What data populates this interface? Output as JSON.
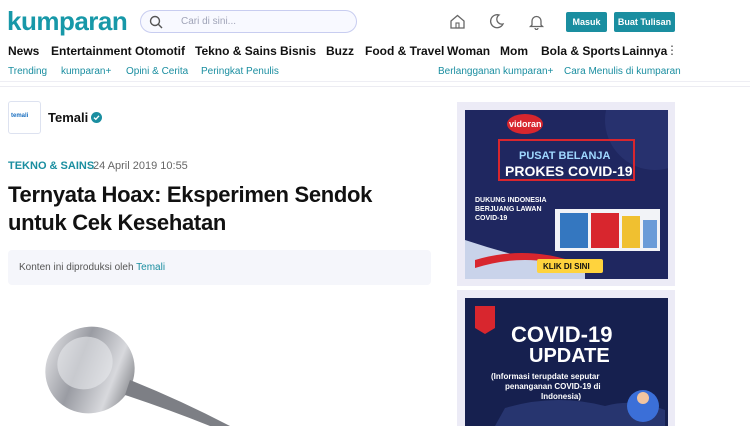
{
  "header": {
    "logo": "kumparan",
    "search_placeholder": "Cari di sini...",
    "login_label": "Masuk",
    "write_label": "Buat Tulisan"
  },
  "nav": {
    "items": [
      "News",
      "Entertainment",
      "Otomotif",
      "Tekno & Sains",
      "Bisnis",
      "Buzz",
      "Food & Travel",
      "Woman",
      "Mom",
      "Bola & Sports",
      "Lainnya"
    ],
    "more": "⋮"
  },
  "subnav": {
    "left": [
      "Trending",
      "kumparan+",
      "Opini & Cerita",
      "Peringkat Penulis"
    ],
    "right": [
      "Berlangganan kumparan+",
      "Cara Menulis di kumparan"
    ]
  },
  "article": {
    "author_logo_text": "temali",
    "author": "Temali",
    "category": "TEKNO & SAINS",
    "date": "24 April 2019 10:55",
    "date_separator": "·",
    "title": "Ternyata Hoax: Eksperimen Sendok untuk Cek Kesehatan",
    "notice_prefix": "Konten ini diproduksi oleh",
    "notice_link": "Temali"
  },
  "ad1": {
    "brand": "vidoran",
    "line1": "PUSAT BELANJA",
    "line2": "PROKES COVID-19",
    "line3": "DUKUNG INDONESIA",
    "line4": "BERJUANG LAWAN",
    "line5": "COVID-19",
    "cta": "KLIK DI SINI"
  },
  "ad2": {
    "title1": "COVID-19",
    "title2": "UPDATE",
    "sub1": "(Informasi terupdate seputar",
    "sub2": "penanganan COVID-19 di",
    "sub3": "Indonesia)"
  },
  "colors": {
    "brand": "#1798a8",
    "button": "#1a8ea0",
    "ad_bg": "#1f2760",
    "accent_red": "#d8262e"
  }
}
